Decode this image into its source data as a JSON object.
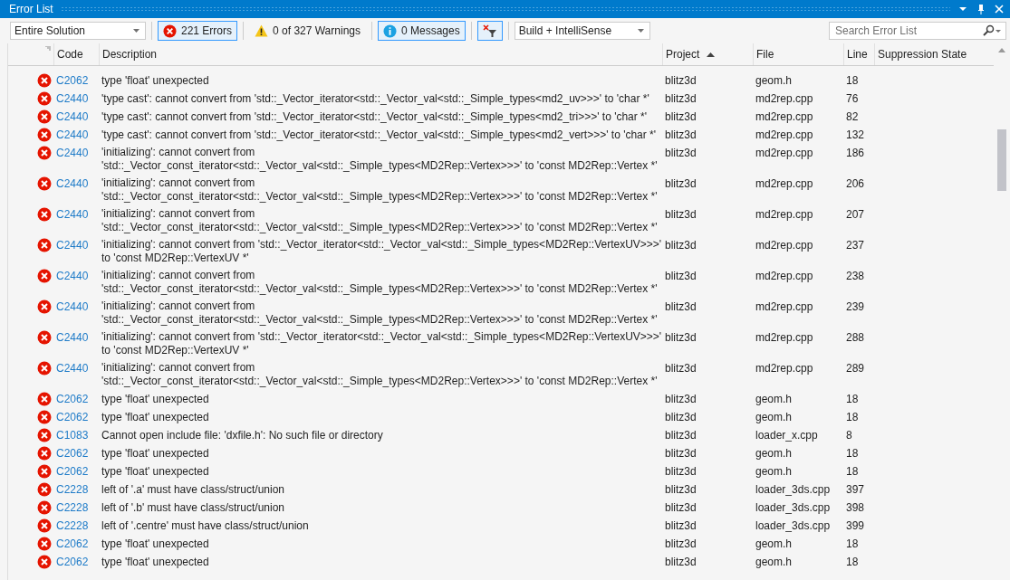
{
  "window": {
    "title": "Error List"
  },
  "toolbar": {
    "scope": "Entire Solution",
    "errors": {
      "label": "221 Errors",
      "selected": true
    },
    "warnings": {
      "label": "0 of 327 Warnings",
      "selected": false
    },
    "messages": {
      "label": "0 Messages",
      "selected": true
    },
    "build_filter": "Build + IntelliSense",
    "search": {
      "placeholder": "Search Error List"
    }
  },
  "table": {
    "columns": [
      {
        "label": "Code"
      },
      {
        "label": "Description"
      },
      {
        "label": "Project",
        "sorted": true
      },
      {
        "label": "File"
      },
      {
        "label": "Line"
      },
      {
        "label": "Suppression State"
      }
    ],
    "rows": [
      {
        "code": "C2062",
        "description": "type 'float' unexpected",
        "project": "blitz3d",
        "file": "geom.h",
        "line": "18"
      },
      {
        "code": "C2440",
        "description": "'type cast': cannot convert from 'std::_Vector_iterator<std::_Vector_val<std::_Simple_types<md2_uv>>>' to 'char *'",
        "project": "blitz3d",
        "file": "md2rep.cpp",
        "line": "76"
      },
      {
        "code": "C2440",
        "description": "'type cast': cannot convert from 'std::_Vector_iterator<std::_Vector_val<std::_Simple_types<md2_tri>>>' to 'char *'",
        "project": "blitz3d",
        "file": "md2rep.cpp",
        "line": "82"
      },
      {
        "code": "C2440",
        "description": "'type cast': cannot convert from 'std::_Vector_iterator<std::_Vector_val<std::_Simple_types<md2_vert>>>' to 'char *'",
        "project": "blitz3d",
        "file": "md2rep.cpp",
        "line": "132"
      },
      {
        "code": "C2440",
        "description": "'initializing': cannot convert from\n'std::_Vector_const_iterator<std::_Vector_val<std::_Simple_types<MD2Rep::Vertex>>>' to 'const MD2Rep::Vertex *'",
        "project": "blitz3d",
        "file": "md2rep.cpp",
        "line": "186"
      },
      {
        "code": "C2440",
        "description": "'initializing': cannot convert from\n'std::_Vector_const_iterator<std::_Vector_val<std::_Simple_types<MD2Rep::Vertex>>>' to 'const MD2Rep::Vertex *'",
        "project": "blitz3d",
        "file": "md2rep.cpp",
        "line": "206"
      },
      {
        "code": "C2440",
        "description": "'initializing': cannot convert from\n'std::_Vector_const_iterator<std::_Vector_val<std::_Simple_types<MD2Rep::Vertex>>>' to 'const MD2Rep::Vertex *'",
        "project": "blitz3d",
        "file": "md2rep.cpp",
        "line": "207"
      },
      {
        "code": "C2440",
        "description": "'initializing': cannot convert from 'std::_Vector_iterator<std::_Vector_val<std::_Simple_types<MD2Rep::VertexUV>>>'\nto 'const MD2Rep::VertexUV *'",
        "project": "blitz3d",
        "file": "md2rep.cpp",
        "line": "237"
      },
      {
        "code": "C2440",
        "description": "'initializing': cannot convert from\n'std::_Vector_const_iterator<std::_Vector_val<std::_Simple_types<MD2Rep::Vertex>>>' to 'const MD2Rep::Vertex *'",
        "project": "blitz3d",
        "file": "md2rep.cpp",
        "line": "238"
      },
      {
        "code": "C2440",
        "description": "'initializing': cannot convert from\n'std::_Vector_const_iterator<std::_Vector_val<std::_Simple_types<MD2Rep::Vertex>>>' to 'const MD2Rep::Vertex *'",
        "project": "blitz3d",
        "file": "md2rep.cpp",
        "line": "239"
      },
      {
        "code": "C2440",
        "description": "'initializing': cannot convert from 'std::_Vector_iterator<std::_Vector_val<std::_Simple_types<MD2Rep::VertexUV>>>'\nto 'const MD2Rep::VertexUV *'",
        "project": "blitz3d",
        "file": "md2rep.cpp",
        "line": "288"
      },
      {
        "code": "C2440",
        "description": "'initializing': cannot convert from\n'std::_Vector_const_iterator<std::_Vector_val<std::_Simple_types<MD2Rep::Vertex>>>' to 'const MD2Rep::Vertex *'",
        "project": "blitz3d",
        "file": "md2rep.cpp",
        "line": "289"
      },
      {
        "code": "C2062",
        "description": "type 'float' unexpected",
        "project": "blitz3d",
        "file": "geom.h",
        "line": "18"
      },
      {
        "code": "C2062",
        "description": "type 'float' unexpected",
        "project": "blitz3d",
        "file": "geom.h",
        "line": "18"
      },
      {
        "code": "C1083",
        "description": "Cannot open include file: 'dxfile.h': No such file or directory",
        "project": "blitz3d",
        "file": "loader_x.cpp",
        "line": "8"
      },
      {
        "code": "C2062",
        "description": "type 'float' unexpected",
        "project": "blitz3d",
        "file": "geom.h",
        "line": "18"
      },
      {
        "code": "C2062",
        "description": "type 'float' unexpected",
        "project": "blitz3d",
        "file": "geom.h",
        "line": "18"
      },
      {
        "code": "C2228",
        "description": "left of '.a' must have class/struct/union",
        "project": "blitz3d",
        "file": "loader_3ds.cpp",
        "line": "397"
      },
      {
        "code": "C2228",
        "description": "left of '.b' must have class/struct/union",
        "project": "blitz3d",
        "file": "loader_3ds.cpp",
        "line": "398"
      },
      {
        "code": "C2228",
        "description": "left of '.centre' must have class/struct/union",
        "project": "blitz3d",
        "file": "loader_3ds.cpp",
        "line": "399"
      },
      {
        "code": "C2062",
        "description": "type 'float' unexpected",
        "project": "blitz3d",
        "file": "geom.h",
        "line": "18"
      },
      {
        "code": "C2062",
        "description": "type 'float' unexpected",
        "project": "blitz3d",
        "file": "geom.h",
        "line": "18"
      }
    ]
  }
}
